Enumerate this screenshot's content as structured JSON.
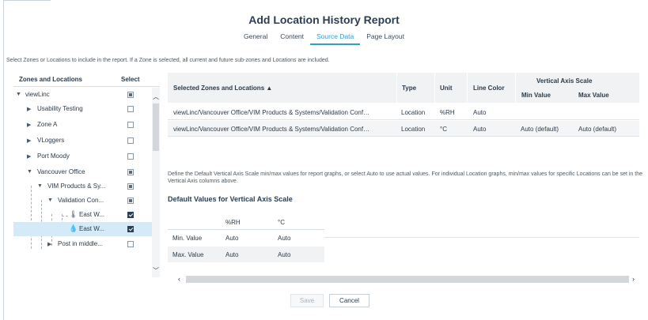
{
  "dialog": {
    "title": "Add Location History Report",
    "tabs": [
      "General",
      "Content",
      "Source Data",
      "Page Layout"
    ],
    "active_tab": "Source Data"
  },
  "instructions": "Select Zones or Locations to include in the report. If a Zone is selected, all current and future sub-zones and Locations are included.",
  "tree": {
    "col_zones": "Zones and Locations",
    "col_select": "Select",
    "items": [
      {
        "label": "viewLinc",
        "state": "partial"
      },
      {
        "label": "Usability Testing",
        "state": "unchecked"
      },
      {
        "label": "Zone A",
        "state": "unchecked"
      },
      {
        "label": "VLoggers",
        "state": "unchecked"
      },
      {
        "label": "Port Moody",
        "state": "unchecked"
      },
      {
        "label": "Vancouver Office",
        "state": "partial"
      },
      {
        "label": "VIM Products & Sy...",
        "state": "partial"
      },
      {
        "label": "Validation Con...",
        "state": "partial"
      },
      {
        "label": "East W...",
        "state": "checked",
        "icon": "thermometer-icon"
      },
      {
        "label": "East W...",
        "state": "checked",
        "icon": "humidity-drop-icon"
      },
      {
        "label": "Post in middle...",
        "state": "unchecked"
      }
    ]
  },
  "grid": {
    "headers": {
      "zones": "Selected Zones and Locations ▲",
      "type": "Type",
      "unit": "Unit",
      "color": "Line Color",
      "vas": "Vertical Axis Scale",
      "min": "Min Value",
      "max": "Max Value"
    },
    "rows": [
      {
        "path": "viewLinc/Vancouver Office/VIM Products & Systems/Validation Conf…",
        "type": "Location",
        "unit": "%RH",
        "color": "Auto",
        "min": "",
        "max": ""
      },
      {
        "path": "viewLinc/Vancouver Office/VIM Products & Systems/Validation Conf…",
        "type": "Location",
        "unit": "°C",
        "color": "Auto",
        "min": "Auto (default)",
        "max": "Auto (default)"
      }
    ]
  },
  "description": "Define the Default Vertical Axis Scale min/max values for report graphs, or select Auto to use actual values. For individual Location graphs, min/max values for specific Locations can be set in the Vertical Axis columns above.",
  "defaults": {
    "title": "Default Values for Vertical Axis Scale",
    "col_rh": "%RH",
    "col_c": "°C",
    "rows": [
      {
        "label": "Min. Value",
        "rh": "Auto",
        "c": "Auto"
      },
      {
        "label": "Max. Value",
        "rh": "Auto",
        "c": "Auto"
      }
    ]
  },
  "buttons": {
    "save": "Save",
    "cancel": "Cancel"
  },
  "colors": {
    "accent": "#2aa0d8",
    "title": "#2b3e55",
    "selected_row": "#d4ebf7"
  }
}
